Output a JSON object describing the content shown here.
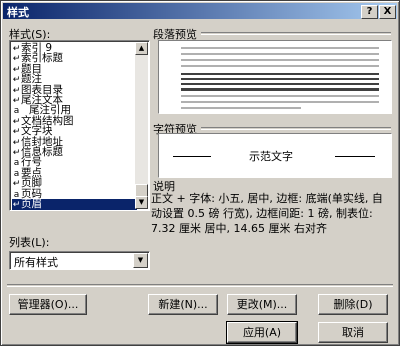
{
  "window": {
    "title": "样式",
    "help_btn": "?",
    "close_btn": "X"
  },
  "styles_label": "样式(S):",
  "styles": [
    {
      "icon": "↵",
      "label": "索引 9"
    },
    {
      "icon": "↵",
      "label": "索引标题"
    },
    {
      "icon": "↵",
      "label": "题目"
    },
    {
      "icon": "↵",
      "label": "题注"
    },
    {
      "icon": "↵",
      "label": "图表目录"
    },
    {
      "icon": "↵",
      "label": "尾注文本"
    },
    {
      "icon": "a",
      "label": "尾注引用",
      "indent": true
    },
    {
      "icon": "↵",
      "label": "文档结构图"
    },
    {
      "icon": "↵",
      "label": "文字块"
    },
    {
      "icon": "↵",
      "label": "信封地址"
    },
    {
      "icon": "↵",
      "label": "信息标题"
    },
    {
      "icon": "a",
      "label": "行号"
    },
    {
      "icon": "a",
      "label": "要点"
    },
    {
      "icon": "↵",
      "label": "页脚"
    },
    {
      "icon": "a",
      "label": "页码"
    },
    {
      "icon": "↵",
      "label": "页眉"
    }
  ],
  "selected_index": 15,
  "para_preview_label": "段落预览",
  "char_preview_label": "字符预览",
  "char_preview_text": "示范文字",
  "desc_label": "说明",
  "description": "正文 + 字体: 小五, 居中, 边框: 底端(单实线, 自动设置 0.5 磅 行宽), 边框间距: 1 磅, 制表位: 7.32 厘米 居中, 14.65 厘米 右对齐",
  "list_label": "列表(L):",
  "list_value": "所有样式",
  "buttons": {
    "organizer": "管理器(O)...",
    "new": "新建(N)...",
    "modify": "更改(M)...",
    "delete": "删除(D)",
    "apply": "应用(A)",
    "cancel": "取消"
  }
}
